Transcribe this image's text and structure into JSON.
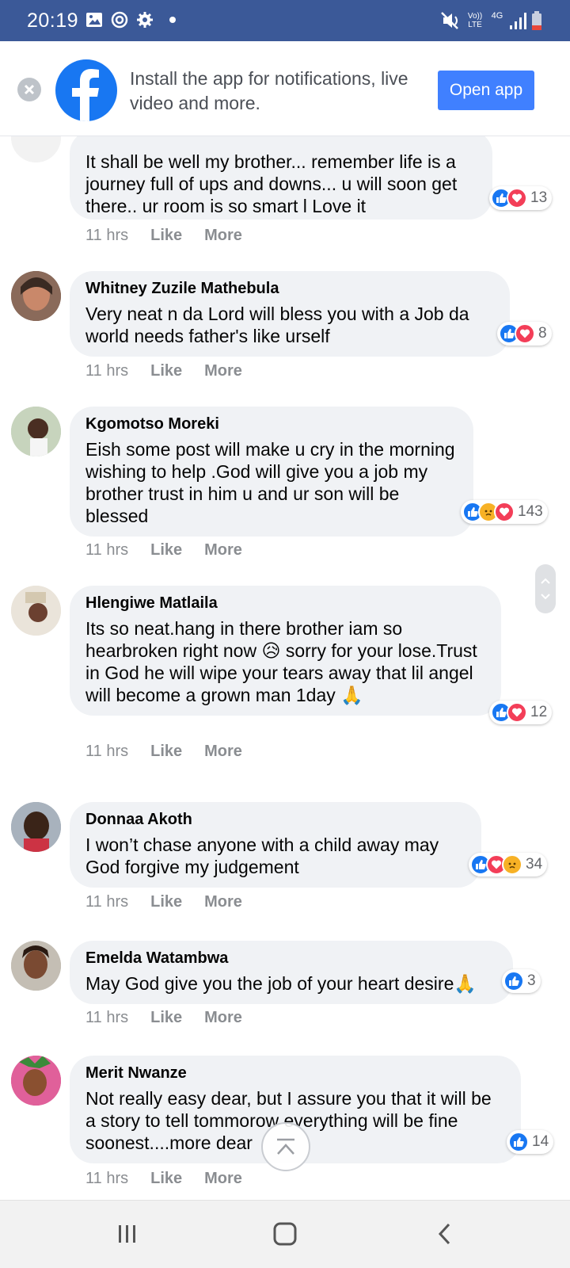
{
  "status_bar": {
    "time": "20:19",
    "network_labels": [
      "Vo)) LTE",
      "4G"
    ]
  },
  "banner": {
    "text": "Install the app for notifications, live video and more.",
    "button": "Open app",
    "close_icon": "close-icon",
    "logo": "facebook-logo"
  },
  "comments": [
    {
      "name": "",
      "text": "It shall be well my brother... remember life is a journey full of ups and downs... u will soon get there.. ur room is so smart l Love it",
      "reactions": [
        "like",
        "love"
      ],
      "count": "13",
      "time": "11 hrs",
      "like": "Like",
      "more": "More"
    },
    {
      "name": "Whitney Zuzile Mathebula",
      "text": "Very neat n da Lord will bless you with a Job da world needs father's like urself",
      "reactions": [
        "like",
        "love"
      ],
      "count": "8",
      "time": "11 hrs",
      "like": "Like",
      "more": "More"
    },
    {
      "name": "Kgomotso Moreki",
      "text": "Eish some post will make u cry in the morning wishing to help .God will give you a job my brother trust in him u and ur son will be blessed",
      "reactions": [
        "like",
        "sad",
        "love"
      ],
      "count": "143",
      "time": "11 hrs",
      "like": "Like",
      "more": "More"
    },
    {
      "name": "Hlengiwe Matlaila",
      "text": "Its so neat.hang in there brother iam so hearbroken right now 😥 sorry for your lose.Trust in God he will wipe your tears away that lil angel will become a grown man 1day 🙏",
      "reactions": [
        "like",
        "love"
      ],
      "count": "12",
      "time": "11 hrs",
      "like": "Like",
      "more": "More"
    },
    {
      "name": "Donnaa Akoth",
      "text": "I won’t chase anyone with a child away may God forgive my judgement",
      "reactions": [
        "like",
        "love",
        "sad"
      ],
      "count": "34",
      "time": "11 hrs",
      "like": "Like",
      "more": "More"
    },
    {
      "name": "Emelda Watambwa",
      "text": "May God give you the job of your heart desire🙏",
      "reactions": [
        "like"
      ],
      "count": "3",
      "time": "11 hrs",
      "like": "Like",
      "more": "More"
    },
    {
      "name": "Merit Nwanze",
      "text": "Not really easy dear, but I assure you that it will be a story to tell tommorow everything will be fine soonest....more dear",
      "reactions": [
        "like"
      ],
      "count": "14",
      "time": "11 hrs",
      "like": "Like",
      "more": "More"
    }
  ],
  "colors": {
    "status_bar": "#3b5998",
    "brand": "#1877f2",
    "button": "#4080ff",
    "bubble": "#f0f2f5",
    "love": "#f33e58",
    "sad": "#f7b125"
  }
}
